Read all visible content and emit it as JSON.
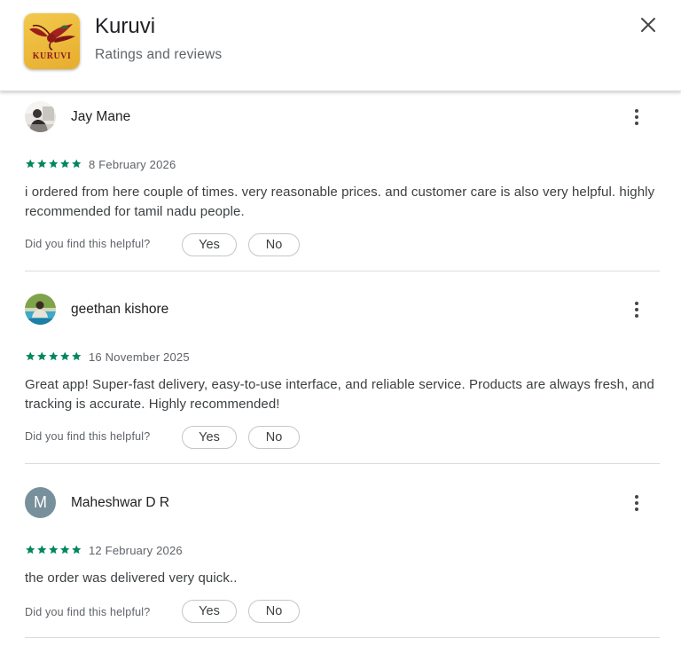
{
  "header": {
    "app_name": "Kuruvi",
    "subtitle": "Ratings and reviews",
    "icon_text": "KURUVI",
    "close_icon": "close-icon"
  },
  "colors": {
    "star": "#01875f",
    "avatar_m": "#78909c"
  },
  "helpful_prompt": "Did you find this helpful?",
  "reviews": [
    {
      "name": "Jay Mane",
      "avatar": "photo",
      "rating": 5,
      "date": "8 February 2026",
      "text": "i ordered from here couple of times. very reasonable prices. and customer care is also very helpful. highly recommended for tamil nadu people.",
      "yes_label": "Yes",
      "no_label": "No"
    },
    {
      "name": "geethan kishore",
      "avatar": "photo",
      "rating": 5,
      "date": "16 November 2025",
      "text": "Great app! Super-fast delivery, easy-to-use interface, and reliable service. Products are always fresh, and tracking is accurate. Highly recommended!",
      "yes_label": "Yes",
      "no_label": "No"
    },
    {
      "name": "Maheshwar D R",
      "avatar_letter": "M",
      "rating": 5,
      "date": "12 February 2026",
      "text": "the order was delivered very quick..",
      "yes_label": "Yes",
      "no_label": "No"
    }
  ]
}
